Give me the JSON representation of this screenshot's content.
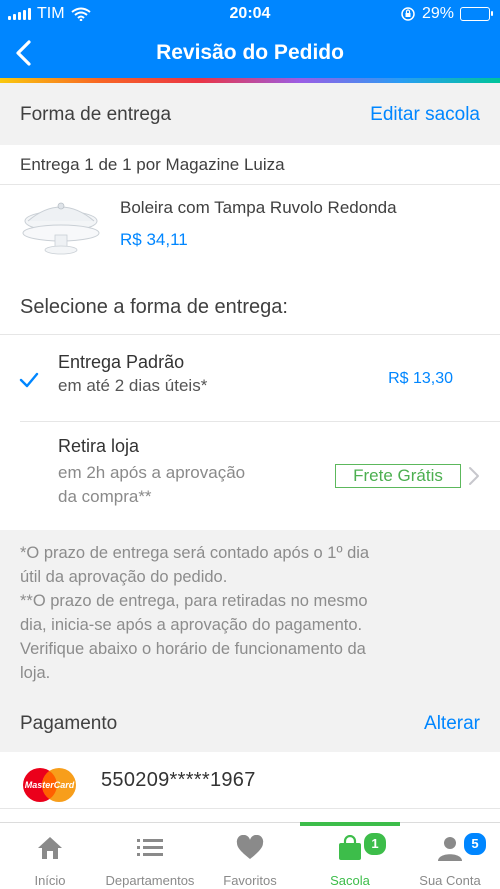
{
  "status_bar": {
    "carrier": "TIM",
    "time": "20:04",
    "battery": "29%",
    "battery_level": 0.29
  },
  "header": {
    "title": "Revisão do Pedido"
  },
  "delivery_section": {
    "label": "Forma de entrega",
    "action": "Editar sacola"
  },
  "shipment": {
    "label_bold": "Entrega 1 de 1",
    "label_rest": " por Magazine Luiza",
    "product": {
      "name": "Boleira com Tampa Ruvolo Redonda",
      "price": "R$ 34,11"
    }
  },
  "select_title": "Selecione a forma de entrega:",
  "options": [
    {
      "title": "Entrega Padrão",
      "subtitle": "em até 2 dias úteis*",
      "price": "R$ 13,30",
      "selected": true
    },
    {
      "title": "Retira loja",
      "subtitle_line1": "em 2h após a aprovação",
      "subtitle_line2": "da compra**",
      "badge": "Frete Grátis",
      "selected": false
    }
  ],
  "notes": {
    "line1": "*O prazo de entrega será contado após o 1º dia",
    "line2": "útil da aprovação do pedido.",
    "line3": "**O prazo de entrega, para retiradas no mesmo",
    "line4": "dia, inicia-se após a aprovação do pagamento.",
    "line5": "Verifique abaixo o horário de funcionamento da",
    "line6": "loja."
  },
  "payment_section": {
    "label": "Pagamento",
    "action": "Alterar"
  },
  "payment": {
    "card_brand_text": "MasterCard",
    "card_number": "550209*****1967"
  },
  "tabbar": {
    "tabs": [
      {
        "label": "Início",
        "icon": "home-icon"
      },
      {
        "label": "Departamentos",
        "icon": "menu-icon"
      },
      {
        "label": "Favoritos",
        "icon": "heart-icon"
      },
      {
        "label": "Sacola",
        "icon": "bag-icon",
        "badge": "1",
        "active": true
      },
      {
        "label": "Sua Conta",
        "icon": "user-icon",
        "badge": "5"
      }
    ]
  },
  "colors": {
    "primary": "#0086ff",
    "success": "#3dbd4a",
    "text": "#404040",
    "muted": "#8c8c8c"
  }
}
